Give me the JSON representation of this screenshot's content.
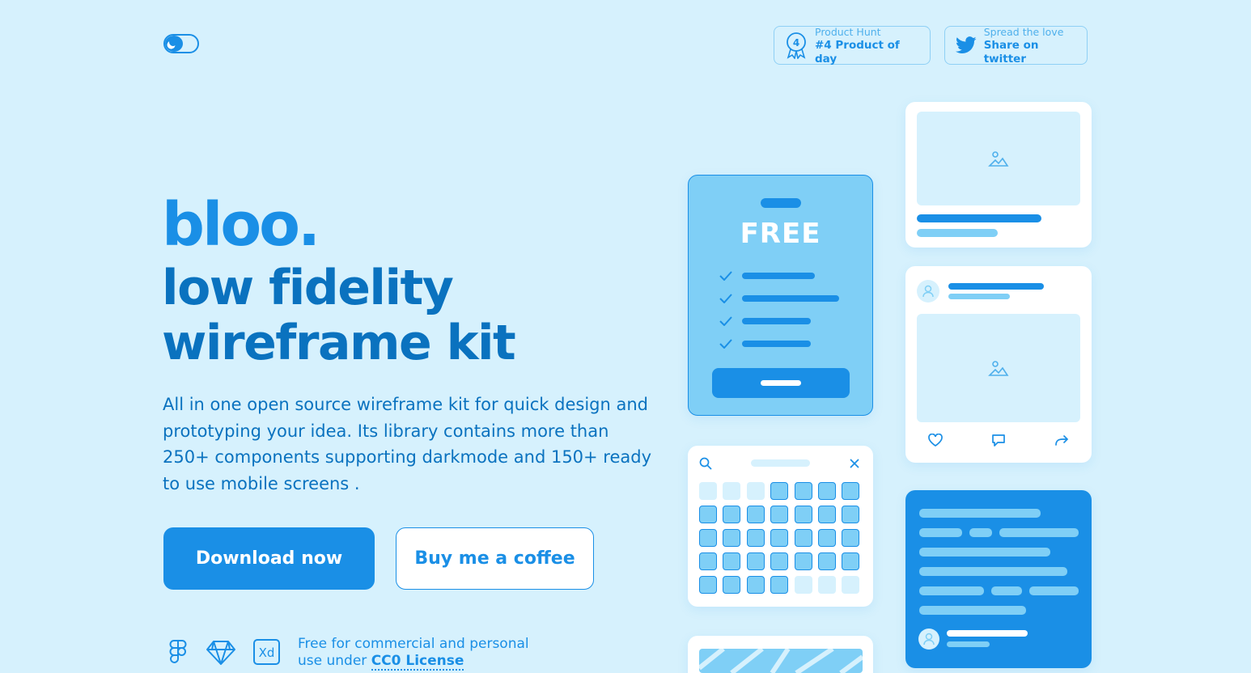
{
  "header": {
    "darkmode_toggle": "moon-icon",
    "product_hunt": {
      "rank_badge": "4",
      "label": "Product Hunt",
      "title": "#4 Product of day"
    },
    "twitter": {
      "label": "Spread the love",
      "title": "Share on twitter"
    }
  },
  "hero": {
    "logo": "bloo.",
    "headline_line1": "low fidelity",
    "headline_line2": "wireframe kit",
    "description": "All in one open source wireframe kit for quick design and prototyping your idea. Its library contains more than 250+ components supporting darkmode and 150+ ready to use mobile screens .",
    "download_label": "Download now",
    "coffee_label": "Buy me a coffee"
  },
  "footer": {
    "tools": [
      "figma-icon",
      "sketch-icon",
      "adobe-xd-icon"
    ],
    "license_line1": "Free for commercial and personal",
    "license_line2_prefix": "use under",
    "license_link": "CC0 License"
  },
  "preview": {
    "pricing_title": "FREE"
  },
  "colors": {
    "background": "#d6f1fd",
    "primary": "#1a8fe6",
    "dark_text": "#0a72bf",
    "light_fill": "#7fcff6"
  }
}
